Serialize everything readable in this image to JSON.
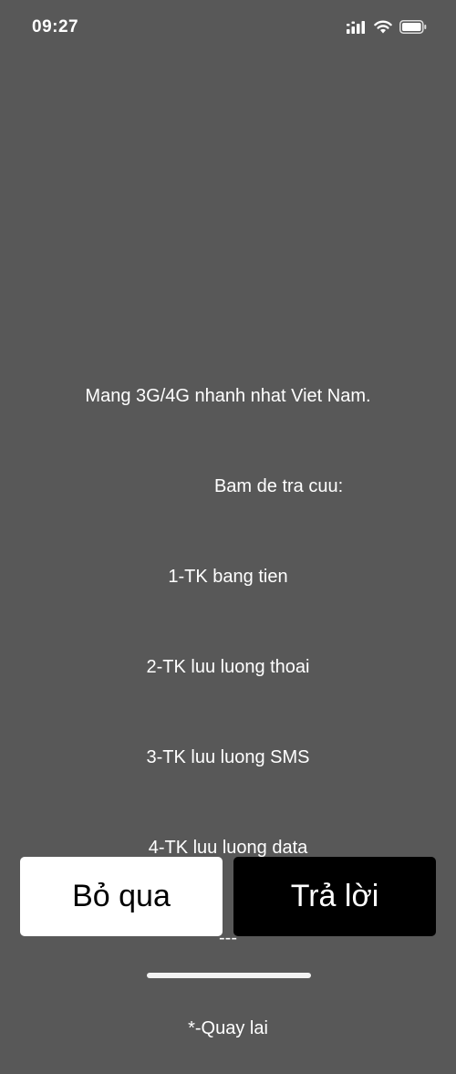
{
  "status_bar": {
    "time": "09:27",
    "icons": [
      "cellular-signal-icon",
      "wifi-icon",
      "battery-icon"
    ]
  },
  "ussd": {
    "lines": [
      "Mang 3G/4G nhanh nhat Viet Nam.",
      "                    Bam de tra cuu:",
      "1-TK bang tien",
      "2-TK luu luong thoai",
      "3-TK luu luong SMS",
      "4-TK luu luong data",
      "---",
      "*-Quay lai"
    ]
  },
  "actions": {
    "skip_label": "Bỏ qua",
    "reply_label": "Trả lời"
  },
  "colors": {
    "background": "#585858",
    "skip_button": "#ffffff",
    "reply_button": "#000000",
    "text": "#ffffff"
  }
}
